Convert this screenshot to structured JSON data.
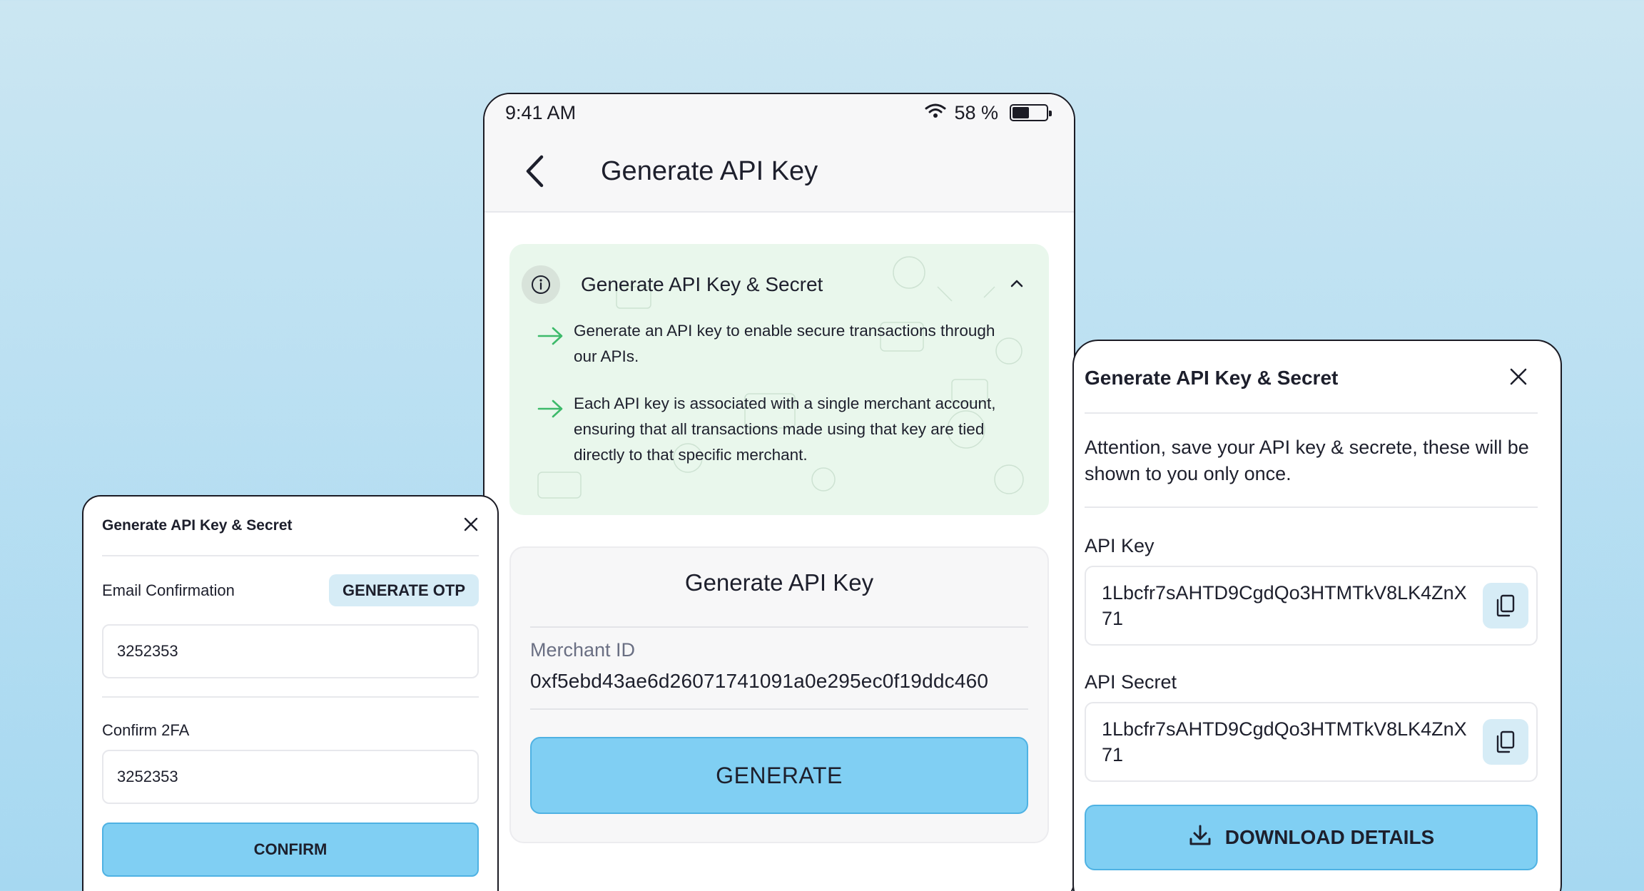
{
  "colors": {
    "accent": "#80cff3",
    "accent_border": "#4fb2e3",
    "info_bg": "#e9f7ec",
    "arrow_green": "#3dba6a",
    "copy_bg": "#d6ecf6"
  },
  "phone": {
    "status_bar": {
      "time": "9:41 AM",
      "battery_text": "58 %",
      "battery_level": 0.58
    },
    "header": {
      "title": "Generate API Key",
      "back_icon": "chevron-left-icon"
    },
    "info": {
      "title": "Generate API Key & Secret",
      "icon": "info-icon",
      "collapse_icon": "chevron-up-icon",
      "bullets": [
        "Generate an API key to enable secure transactions through our APIs.",
        "Each API key is associated with a single merchant account, ensuring that all transactions made using that key are tied directly to that specific merchant."
      ]
    },
    "generate_card": {
      "title": "Generate API Key",
      "merchant_label": "Merchant ID",
      "merchant_value": "0xf5ebd43ae6d26071741091a0e295ec0f19ddc460",
      "button_label": "GENERATE"
    }
  },
  "left_modal": {
    "title": "Generate API Key & Secret",
    "email_label": "Email Confirmation",
    "otp_button": "GENERATE OTP",
    "email_code": "3252353",
    "twofa_label": "Confirm 2FA",
    "twofa_code": "3252353",
    "confirm_button": "CONFIRM"
  },
  "right_modal": {
    "title": "Generate API Key & Secret",
    "note": "Attention, save your API key & secrete, these will be shown to you only once.",
    "api_key_label": "API Key",
    "api_key_value": "1Lbcfr7sAHTD9CgdQo3HTMTkV8LK4ZnX71",
    "api_secret_label": "API Secret",
    "api_secret_value": "1Lbcfr7sAHTD9CgdQo3HTMTkV8LK4ZnX71",
    "download_button": "DOWNLOAD DETAILS",
    "download_icon": "download-icon",
    "copy_icon": "copy-icon"
  }
}
